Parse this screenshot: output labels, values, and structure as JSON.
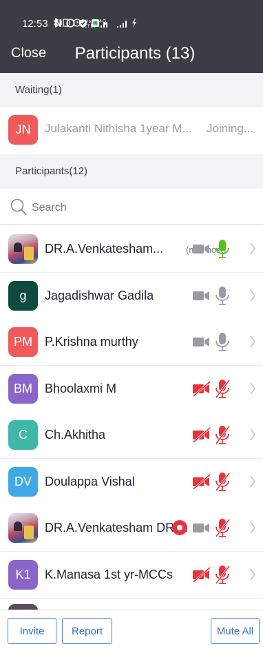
{
  "status_bar": {
    "time": "12:53",
    "right_icons": "bluetooth vibrate alarm volte 4G signal signal battery-charging"
  },
  "nav": {
    "close_label": "Close",
    "title": "Participants (13)"
  },
  "waiting": {
    "header": "Waiting(1)",
    "rows": [
      {
        "initials": "JN",
        "color": "#f05a5a",
        "name": "Julakanti Nithisha 1year M...",
        "status": "Joining..."
      }
    ]
  },
  "participants": {
    "header": "Participants(12)",
    "search_placeholder": "Search",
    "rows": [
      {
        "initials": "",
        "avatar_type": "photo",
        "name": "DR.A.Venkatesham...",
        "meta": "(me, host)",
        "video": "off-grey",
        "audio": "on-green",
        "recording": false
      },
      {
        "initials": "g",
        "color": "#0f4a3e",
        "name": "Jagadishwar Gadila",
        "meta": "",
        "video": "off-grey",
        "audio": "muted-grey",
        "recording": false
      },
      {
        "initials": "PM",
        "color": "#f05a5a",
        "name": "P.Krishna murthy",
        "meta": "",
        "video": "off-grey",
        "audio": "muted-grey",
        "recording": false
      },
      {
        "initials": "BM",
        "color": "#8a66c8",
        "name": "Bhoolaxmi M",
        "meta": "",
        "video": "off-red",
        "audio": "muted-red",
        "recording": false
      },
      {
        "initials": "C",
        "color": "#3fb8a8",
        "name": "Ch.Akhitha",
        "meta": "",
        "video": "off-red",
        "audio": "muted-red",
        "recording": false
      },
      {
        "initials": "DV",
        "color": "#3fa9e6",
        "name": "Doulappa Vishal",
        "meta": "",
        "video": "off-red",
        "audio": "muted-red",
        "recording": false
      },
      {
        "initials": "",
        "avatar_type": "photo",
        "name": "DR.A.Venkatesham DR....",
        "meta": "",
        "video": "off-grey",
        "audio": "muted-red",
        "recording": true
      },
      {
        "initials": "K1",
        "color": "#8a66c8",
        "name": "K.Manasa 1st yr-MCCs",
        "meta": "",
        "video": "off-red",
        "audio": "muted-red",
        "recording": false
      }
    ]
  },
  "bottom_bar": {
    "invite_label": "Invite",
    "report_label": "Report",
    "mute_all_label": "Mute All"
  },
  "colors": {
    "topbar": "#3c3c44",
    "accent_blue": "#2d6fcc",
    "green_mic": "#52c41a",
    "red_off": "#e8323c",
    "grey_icon": "#9b9ba5"
  }
}
